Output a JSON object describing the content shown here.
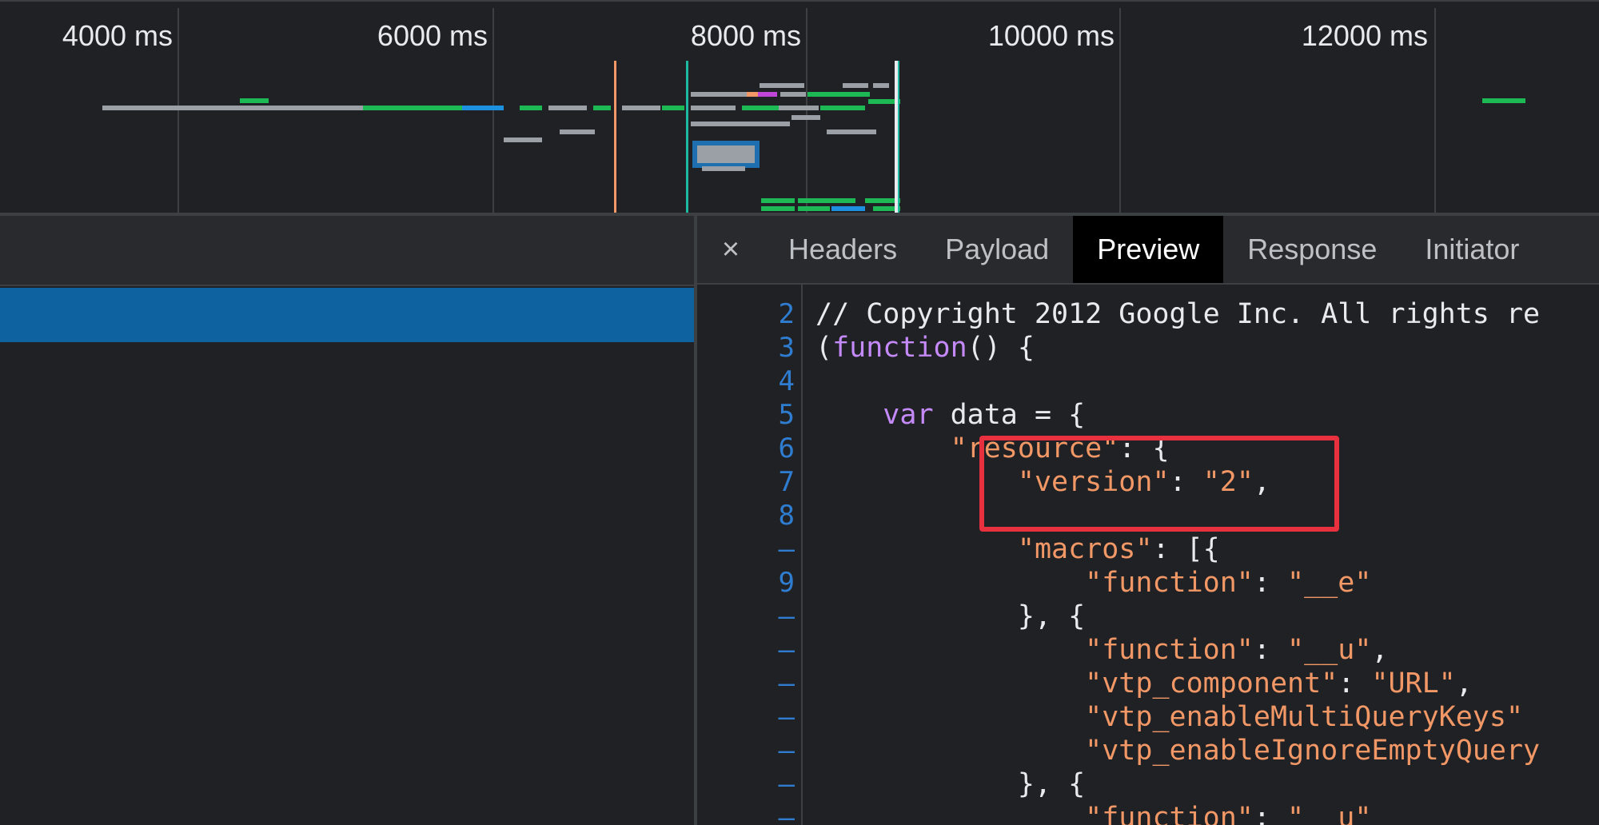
{
  "timeline": {
    "ticks": [
      "4000 ms",
      "6000 ms",
      "8000 ms",
      "10000 ms",
      "12000 ms"
    ]
  },
  "detail": {
    "close_label": "×",
    "tabs": [
      "Headers",
      "Payload",
      "Preview",
      "Response",
      "Initiator"
    ],
    "active_tab": "Preview"
  },
  "code": {
    "lines": [
      {
        "num": "2",
        "indent": "",
        "parts": [
          {
            "t": "// Copyright 2012 Google Inc. All rights re",
            "c": ""
          }
        ]
      },
      {
        "num": "3",
        "indent": "",
        "parts": [
          {
            "t": "(",
            "c": ""
          },
          {
            "t": "function",
            "c": "kw"
          },
          {
            "t": "() {",
            "c": ""
          }
        ]
      },
      {
        "num": "4",
        "indent": "",
        "parts": []
      },
      {
        "num": "5",
        "indent": "    ",
        "parts": [
          {
            "t": "var",
            "c": "kw"
          },
          {
            "t": " data = {",
            "c": ""
          }
        ]
      },
      {
        "num": "6",
        "indent": "        ",
        "parts": [
          {
            "t": "\"resource\"",
            "c": "str"
          },
          {
            "t": ": {",
            "c": ""
          }
        ]
      },
      {
        "num": "7",
        "indent": "            ",
        "parts": [
          {
            "t": "\"version\"",
            "c": "str"
          },
          {
            "t": ": ",
            "c": ""
          },
          {
            "t": "\"2\"",
            "c": "str"
          },
          {
            "t": ",",
            "c": ""
          }
        ]
      },
      {
        "num": "8",
        "indent": "",
        "parts": []
      },
      {
        "num": "–",
        "indent": "            ",
        "parts": [
          {
            "t": "\"macros\"",
            "c": "str"
          },
          {
            "t": ": [{",
            "c": ""
          }
        ]
      },
      {
        "num": "9",
        "indent": "                ",
        "parts": [
          {
            "t": "\"function\"",
            "c": "str"
          },
          {
            "t": ": ",
            "c": ""
          },
          {
            "t": "\"__e\"",
            "c": "str"
          }
        ]
      },
      {
        "num": "–",
        "indent": "            ",
        "parts": [
          {
            "t": "}, {",
            "c": ""
          }
        ]
      },
      {
        "num": "–",
        "indent": "                ",
        "parts": [
          {
            "t": "\"function\"",
            "c": "str"
          },
          {
            "t": ": ",
            "c": ""
          },
          {
            "t": "\"__u\"",
            "c": "str"
          },
          {
            "t": ",",
            "c": ""
          }
        ]
      },
      {
        "num": "–",
        "indent": "                ",
        "parts": [
          {
            "t": "\"vtp_component\"",
            "c": "str"
          },
          {
            "t": ": ",
            "c": ""
          },
          {
            "t": "\"URL\"",
            "c": "str"
          },
          {
            "t": ",",
            "c": ""
          }
        ]
      },
      {
        "num": "–",
        "indent": "                ",
        "parts": [
          {
            "t": "\"vtp_enableMultiQueryKeys\"",
            "c": "str"
          }
        ]
      },
      {
        "num": "–",
        "indent": "                ",
        "parts": [
          {
            "t": "\"vtp_enableIgnoreEmptyQuery",
            "c": "str"
          }
        ]
      },
      {
        "num": "–",
        "indent": "            ",
        "parts": [
          {
            "t": "}, {",
            "c": ""
          }
        ]
      },
      {
        "num": "–",
        "indent": "                ",
        "parts": [
          {
            "t": "\"function\"",
            "c": "str"
          },
          {
            "t": ": ",
            "c": ""
          },
          {
            "t": "\"__u\"",
            "c": "str"
          }
        ]
      }
    ]
  },
  "colors": {
    "selected_row": "#0e62a0",
    "string": "#f29766",
    "keyword": "#c58af9",
    "line_number": "#2f7dd1",
    "highlight_box": "#e8303f"
  }
}
